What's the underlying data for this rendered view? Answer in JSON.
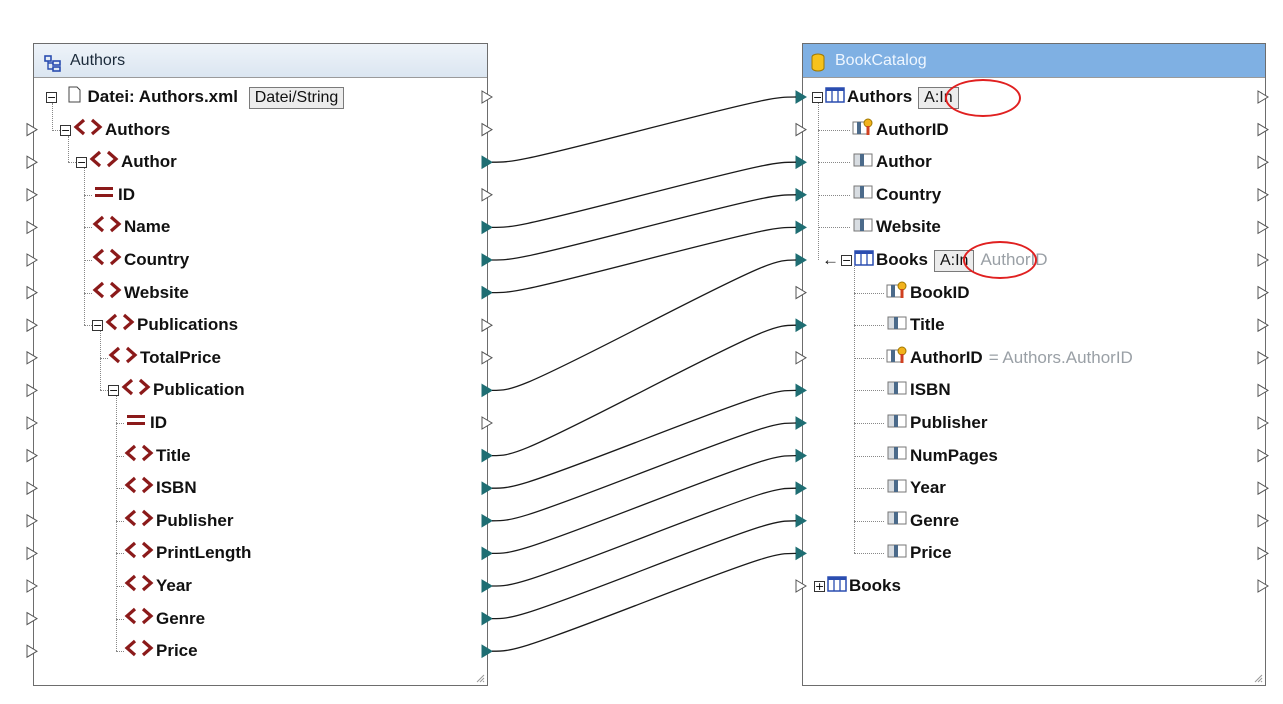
{
  "source": {
    "title": "Authors",
    "file_label": "Datei: Authors.xml",
    "file_button": "Datei/String",
    "items": [
      {
        "label": "Authors",
        "kind": "element"
      },
      {
        "label": "Author",
        "kind": "element"
      },
      {
        "label": "ID",
        "kind": "attribute"
      },
      {
        "label": "Name",
        "kind": "element"
      },
      {
        "label": "Country",
        "kind": "element"
      },
      {
        "label": "Website",
        "kind": "element"
      },
      {
        "label": "Publications",
        "kind": "element"
      },
      {
        "label": "TotalPrice",
        "kind": "element"
      },
      {
        "label": "Publication",
        "kind": "element"
      },
      {
        "label": "ID",
        "kind": "attribute"
      },
      {
        "label": "Title",
        "kind": "element"
      },
      {
        "label": "ISBN",
        "kind": "element"
      },
      {
        "label": "Publisher",
        "kind": "element"
      },
      {
        "label": "PrintLength",
        "kind": "element"
      },
      {
        "label": "Year",
        "kind": "element"
      },
      {
        "label": "Genre",
        "kind": "element"
      },
      {
        "label": "Price",
        "kind": "element"
      }
    ]
  },
  "target": {
    "title": "BookCatalog",
    "authors_table": "Authors",
    "authors_button": "A:In",
    "authors_fields": [
      "AuthorID",
      "Author",
      "Country",
      "Website"
    ],
    "books_table": "Books",
    "books_button": "A:In",
    "books_ghost": "AuthorID",
    "books_fields": [
      "BookID",
      "Title",
      "AuthorID",
      "ISBN",
      "Publisher",
      "NumPages",
      "Year",
      "Genre",
      "Price"
    ],
    "books_fk_expr": "= Authors.AuthorID",
    "books_table_collapsed": "Books"
  },
  "colors": {
    "element_icon": "#8b1a1a",
    "connector": "#1f6e73",
    "highlight_circle": "#e02020",
    "target_header": "#7fb0e3"
  }
}
